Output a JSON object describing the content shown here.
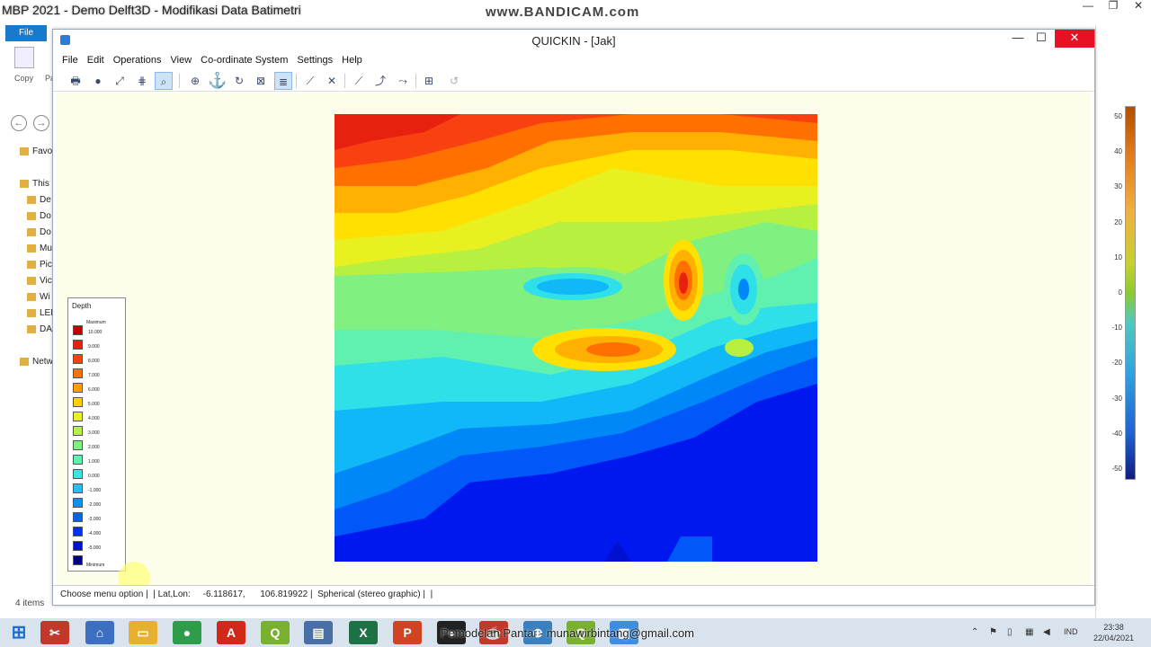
{
  "outer_window": {
    "title": "MBP 2021 - Demo Delft3D - Modifikasi Data Batimetri",
    "watermark": "www.BANDICAM.com",
    "controls": [
      "—",
      "❐",
      "✕"
    ]
  },
  "explorer": {
    "file_tab": "File",
    "ribbon": {
      "copy": "Copy",
      "paste": "Pa"
    },
    "nav": {
      "back": "←",
      "forward": "→"
    },
    "tree": [
      {
        "label": "Favo",
        "icon": "star-icon"
      },
      {
        "label": "This",
        "icon": "computer-icon"
      },
      {
        "label": "De",
        "icon": "folder-icon"
      },
      {
        "label": "Do",
        "icon": "folder-icon"
      },
      {
        "label": "Do",
        "icon": "folder-icon"
      },
      {
        "label": "Mu",
        "icon": "folder-icon"
      },
      {
        "label": "Pic",
        "icon": "folder-icon"
      },
      {
        "label": "Vic",
        "icon": "folder-icon"
      },
      {
        "label": "Wi",
        "icon": "drive-icon"
      },
      {
        "label": "LEI",
        "icon": "drive-icon"
      },
      {
        "label": "DA",
        "icon": "drive-icon"
      },
      {
        "label": "Netw",
        "icon": "network-icon"
      }
    ],
    "item_count": "4 items"
  },
  "colorbar": {
    "ticks": [
      "50",
      "40",
      "30",
      "20",
      "10",
      "0",
      "-10",
      "-20",
      "-30",
      "-40",
      "-50"
    ]
  },
  "quickin": {
    "title": "QUICKIN - [Jak]",
    "menu": [
      "File",
      "Edit",
      "Operations",
      "View",
      "Co-ordinate System",
      "Settings",
      "Help"
    ],
    "toolbar_icons": [
      "print-icon",
      "globe-icon",
      "zoom-extent-icon",
      "grid-icon",
      "zoom-icon",
      "add-point-icon",
      "anchor-icon",
      "refresh-icon",
      "select-icon",
      "list-icon",
      "draw-line-icon",
      "delete-line-icon",
      "polyline-icon",
      "spline-icon",
      "edit-polyline-icon",
      "crosshair-icon",
      "undo-icon"
    ],
    "legend": {
      "title": "Depth",
      "max_label": "Maximum",
      "min_label": "Minimum",
      "entries": [
        {
          "label": "10.000",
          "color": "#c40000"
        },
        {
          "label": "9.000",
          "color": "#e82010"
        },
        {
          "label": "8.000",
          "color": "#f84010"
        },
        {
          "label": "7.000",
          "color": "#ff7000"
        },
        {
          "label": "6.000",
          "color": "#ffa000"
        },
        {
          "label": "5.000",
          "color": "#ffd000"
        },
        {
          "label": "4.000",
          "color": "#e8f020"
        },
        {
          "label": "3.000",
          "color": "#b8f040"
        },
        {
          "label": "2.000",
          "color": "#80f080"
        },
        {
          "label": "1.000",
          "color": "#60f0b0"
        },
        {
          "label": "0.000",
          "color": "#30e8e0"
        },
        {
          "label": "-1.000",
          "color": "#20c0f0"
        },
        {
          "label": "-2.000",
          "color": "#1090f0"
        },
        {
          "label": "-3.000",
          "color": "#0860f0"
        },
        {
          "label": "-4.000",
          "color": "#0030f0"
        },
        {
          "label": "-5.000",
          "color": "#0010d0"
        },
        {
          "label": "",
          "color": "#000080"
        }
      ]
    },
    "status": "Choose menu option |  | Lat,Lon:     -6.118617,      106.819922 |  Spherical (stereo graphic) |  |"
  },
  "taskbar": {
    "apps": [
      {
        "name": "start-button",
        "glyph": "⊞"
      },
      {
        "name": "snipping-app",
        "glyph": "✂",
        "color": "#c0392b"
      },
      {
        "name": "home-app",
        "glyph": "⌂",
        "color": "#3d6fc0"
      },
      {
        "name": "explorer-app",
        "glyph": "▭",
        "color": "#e8b030"
      },
      {
        "name": "chrome-app",
        "glyph": "●",
        "color": "#2e9c48"
      },
      {
        "name": "acrobat-app",
        "glyph": "A",
        "color": "#d2281c"
      },
      {
        "name": "qgis-app",
        "glyph": "Q",
        "color": "#7ab030"
      },
      {
        "name": "delft-app",
        "glyph": "▤",
        "color": "#4a6ea8"
      },
      {
        "name": "excel-app",
        "glyph": "X",
        "color": "#1e7145"
      },
      {
        "name": "powerpoint-app",
        "glyph": "P",
        "color": "#d04423"
      },
      {
        "name": "recorder-app",
        "glyph": "●",
        "color": "#222"
      },
      {
        "name": "java-app",
        "glyph": "☕",
        "color": "#c0392b"
      },
      {
        "name": "network-app",
        "glyph": "⊕",
        "color": "#3a7fc0"
      },
      {
        "name": "qgis2-app",
        "glyph": "Q",
        "color": "#7ab030"
      },
      {
        "name": "quickin-app",
        "glyph": "▦",
        "color": "#3d8ee0"
      }
    ],
    "overlay_text": "Pemodelan Pantai - munawirbintang@gmail.com",
    "lang": "IND",
    "time": "23:38",
    "date": "22/04/2021"
  }
}
